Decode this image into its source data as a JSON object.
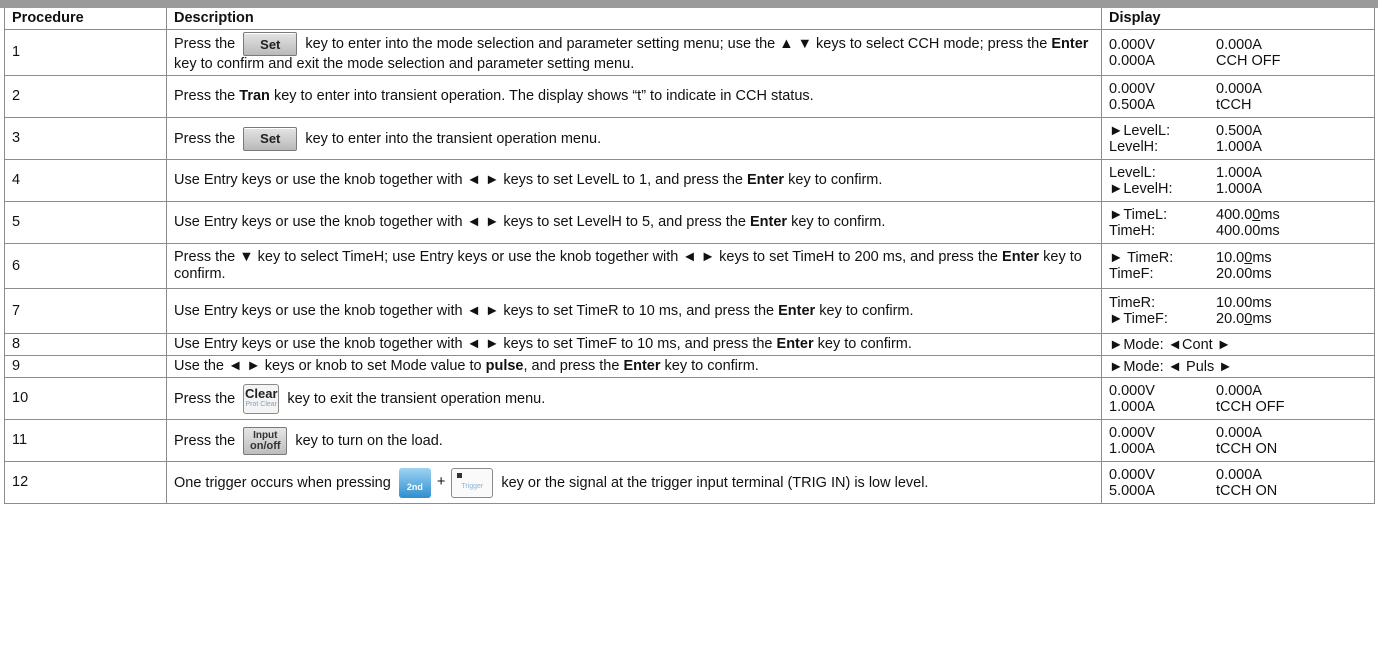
{
  "headers": {
    "procedure": "Procedure",
    "description": "Description",
    "display": "Display"
  },
  "keys": {
    "set": "Set",
    "clear_main": "Clear",
    "clear_sub": "Prot Clear",
    "input_l1": "Input",
    "input_l2": "on/off",
    "second": "2nd",
    "trigger": "Trigger"
  },
  "rows": [
    {
      "num": "1",
      "d1": "Press the",
      "d2": "key to enter into the mode selection and parameter setting menu; use the ▲ ▼ keys to select CCH mode; press the",
      "b1": "Enter",
      "d3": "key to confirm and exit the mode selection and parameter setting menu.",
      "disp": [
        "0.000V",
        "0.000A",
        "0.000A",
        "CCH OFF"
      ]
    },
    {
      "num": "2",
      "d1": "Press the",
      "b1": "Tran",
      "d2": "key to enter into transient operation. The display shows “t” to indicate in CCH status.",
      "disp": [
        "0.000V",
        "0.000A",
        "0.500A",
        "tCCH"
      ]
    },
    {
      "num": "3",
      "d1": "Press the",
      "d2": "key to enter into the transient operation menu.",
      "disp": [
        "►LevelL:",
        "0.500A",
        "LevelH:",
        "1.000A"
      ]
    },
    {
      "num": "4",
      "d1": "Use Entry keys or use the knob together with ◄ ► keys to set LevelL to 1, and press the",
      "b1": "Enter",
      "d2": "key to confirm.",
      "disp": [
        "LevelL:",
        "1.000A",
        "►LevelH:",
        "1.000A"
      ]
    },
    {
      "num": "5",
      "d1": "Use Entry keys or use the knob together with ◄ ► keys to set LevelH to 5, and press the",
      "b1": "Enter",
      "d2": "key to confirm.",
      "disp": [
        "►TimeL:",
        "400.0",
        "0",
        "ms",
        "TimeH:",
        "400.00ms"
      ]
    },
    {
      "num": "6",
      "d1": "Press the ▼ key to select TimeH; use Entry keys or use the knob together with ◄ ► keys to set TimeH to 200 ms, and press the",
      "b1": "Enter",
      "d2": "key to confirm.",
      "disp": [
        "► TimeR:",
        "10.0",
        "0",
        "ms",
        "TimeF:",
        "20.00ms"
      ]
    },
    {
      "num": "7",
      "d1": "Use Entry keys or use the knob together with ◄ ► keys to set TimeR to 10 ms, and press the",
      "b1": "Enter",
      "d2": "key to confirm.",
      "disp": [
        "TimeR:",
        "10.00ms",
        "►TimeF:",
        "20.0",
        "0",
        "ms"
      ]
    },
    {
      "num": "8",
      "d1": "Use Entry keys or use the knob together with ◄ ► keys to set TimeF to 10 ms, and press the",
      "b1": "Enter",
      "d2": "key to confirm.",
      "disp": [
        "►Mode: ◄Cont ►"
      ]
    },
    {
      "num": "9",
      "d1": "Use the ◄ ► keys or knob to set Mode value to",
      "b1": "pulse",
      "d2": ", and press the",
      "b2": "Enter",
      "d3": "key to confirm.",
      "disp": [
        "►Mode: ◄ Puls ►"
      ]
    },
    {
      "num": "10",
      "d1": "Press the",
      "d2": "key to exit the transient operation menu.",
      "disp": [
        "0.000V",
        "0.000A",
        "1.000A",
        "tCCH OFF"
      ]
    },
    {
      "num": "11",
      "d1": "Press the",
      "d2": "key to turn on the load.",
      "disp": [
        "0.000V",
        "0.000A",
        "1.000A",
        "tCCH ON"
      ]
    },
    {
      "num": "12",
      "d1": "One trigger occurs when pressing",
      "plus": "+",
      "d2": "key or the signal at the trigger input terminal (TRIG IN) is low level.",
      "disp": [
        "0.000V",
        "0.000A",
        "5.000A",
        "tCCH ON"
      ]
    }
  ]
}
